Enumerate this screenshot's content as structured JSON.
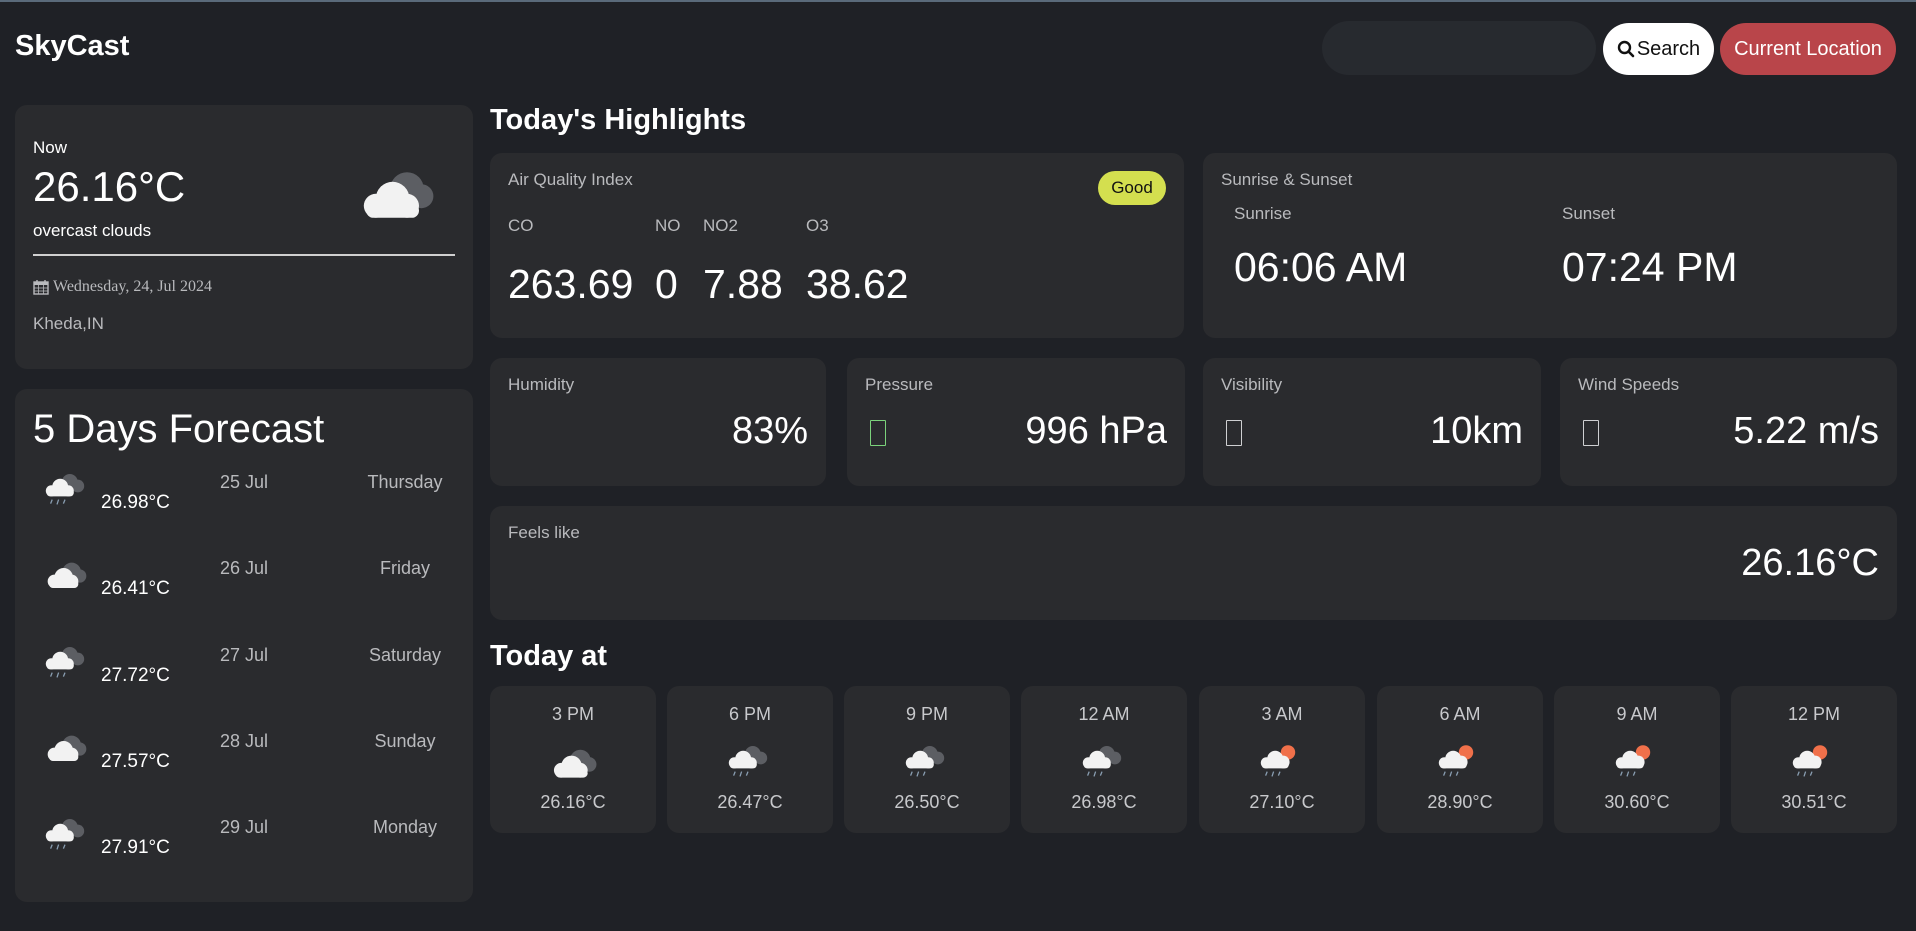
{
  "header": {
    "brand": "SkyCast",
    "search_placeholder": "",
    "search_label": "Search",
    "location_label": "Current Location"
  },
  "now": {
    "label": "Now",
    "temp": "26.16°C",
    "description": "overcast clouds",
    "icon": "overcast-clouds-icon",
    "date": "Wednesday, 24, Jul 2024",
    "location": "Kheda,IN"
  },
  "forecast": {
    "title": "5 Days Forecast",
    "days": [
      {
        "temp": "26.98°C",
        "date": "25 Jul",
        "day": "Thursday",
        "icon": "light-rain-icon"
      },
      {
        "temp": "26.41°C",
        "date": "26 Jul",
        "day": "Friday",
        "icon": "overcast-clouds-icon"
      },
      {
        "temp": "27.72°C",
        "date": "27 Jul",
        "day": "Saturday",
        "icon": "light-rain-icon"
      },
      {
        "temp": "27.57°C",
        "date": "28 Jul",
        "day": "Sunday",
        "icon": "overcast-clouds-icon"
      },
      {
        "temp": "27.91°C",
        "date": "29 Jul",
        "day": "Monday",
        "icon": "light-rain-icon"
      }
    ]
  },
  "highlights": {
    "title": "Today's Highlights",
    "aqi": {
      "label": "Air Quality Index",
      "badge": "Good",
      "badge_color": "#d4df4f",
      "items": [
        {
          "name": "CO",
          "value": "263.69"
        },
        {
          "name": "NO",
          "value": "0"
        },
        {
          "name": "NO2",
          "value": "7.88"
        },
        {
          "name": "O3",
          "value": "38.62"
        }
      ]
    },
    "sun": {
      "label": "Sunrise & Sunset",
      "sunrise_label": "Sunrise",
      "sunrise": "06:06 AM",
      "sunset_label": "Sunset",
      "sunset": "07:24 PM"
    },
    "humidity": {
      "label": "Humidity",
      "value": "83%"
    },
    "pressure": {
      "label": "Pressure",
      "value": "996 hPa"
    },
    "visibility": {
      "label": "Visibility",
      "value": "10km"
    },
    "wind": {
      "label": "Wind Speeds",
      "value": "5.22 m/s"
    },
    "feels_like": {
      "label": "Feels like",
      "value": "26.16°C"
    }
  },
  "today": {
    "title": "Today at",
    "hours": [
      {
        "time": "3 PM",
        "temp": "26.16°C",
        "icon": "overcast-clouds-icon"
      },
      {
        "time": "6 PM",
        "temp": "26.47°C",
        "icon": "light-rain-icon"
      },
      {
        "time": "9 PM",
        "temp": "26.50°C",
        "icon": "light-rain-icon"
      },
      {
        "time": "12 AM",
        "temp": "26.98°C",
        "icon": "light-rain-icon"
      },
      {
        "time": "3 AM",
        "temp": "27.10°C",
        "icon": "sun-rain-icon"
      },
      {
        "time": "6 AM",
        "temp": "28.90°C",
        "icon": "sun-rain-icon"
      },
      {
        "time": "9 AM",
        "temp": "30.60°C",
        "icon": "sun-rain-icon"
      },
      {
        "time": "12 PM",
        "temp": "30.51°C",
        "icon": "sun-rain-icon"
      }
    ]
  },
  "colors": {
    "background": "#1f2126",
    "card": "#2a2b2e",
    "accent_button": "#b9454a",
    "sun": "#f0704a"
  }
}
